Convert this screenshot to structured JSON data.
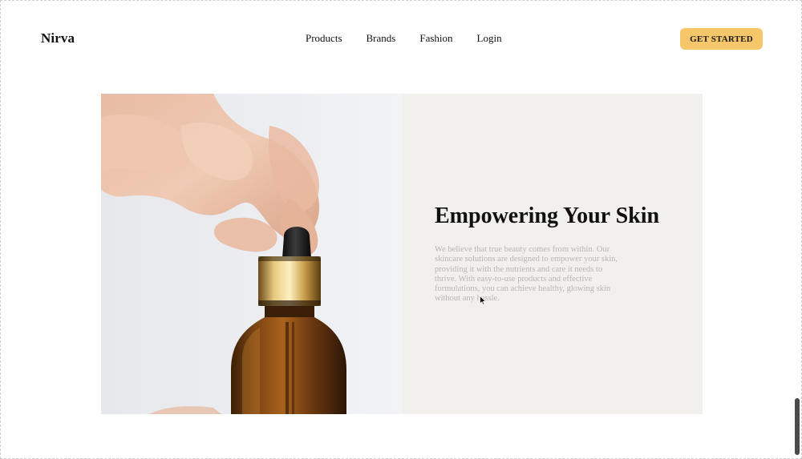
{
  "brand": {
    "logo_text": "Nirva"
  },
  "nav": {
    "items": [
      {
        "label": "Products"
      },
      {
        "label": "Brands"
      },
      {
        "label": "Fashion"
      },
      {
        "label": "Login"
      }
    ],
    "cta_label": "GET STARTED"
  },
  "hero": {
    "title": "Empowering Your Skin",
    "description": "We believe that true beauty comes from within. Our skincare solutions are designed to empower your skin, providing it with the nutrients and care it needs to thrive. With easy-to-use products and effective formulations, you can achieve healthy, glowing skin without any hassle."
  },
  "colors": {
    "accent": "#f6c66a",
    "panel_bg": "#f1f0ec",
    "text_primary": "#111111",
    "text_muted": "#b7b6b2"
  },
  "icons": {
    "cursor": "pointer-cursor-icon"
  }
}
